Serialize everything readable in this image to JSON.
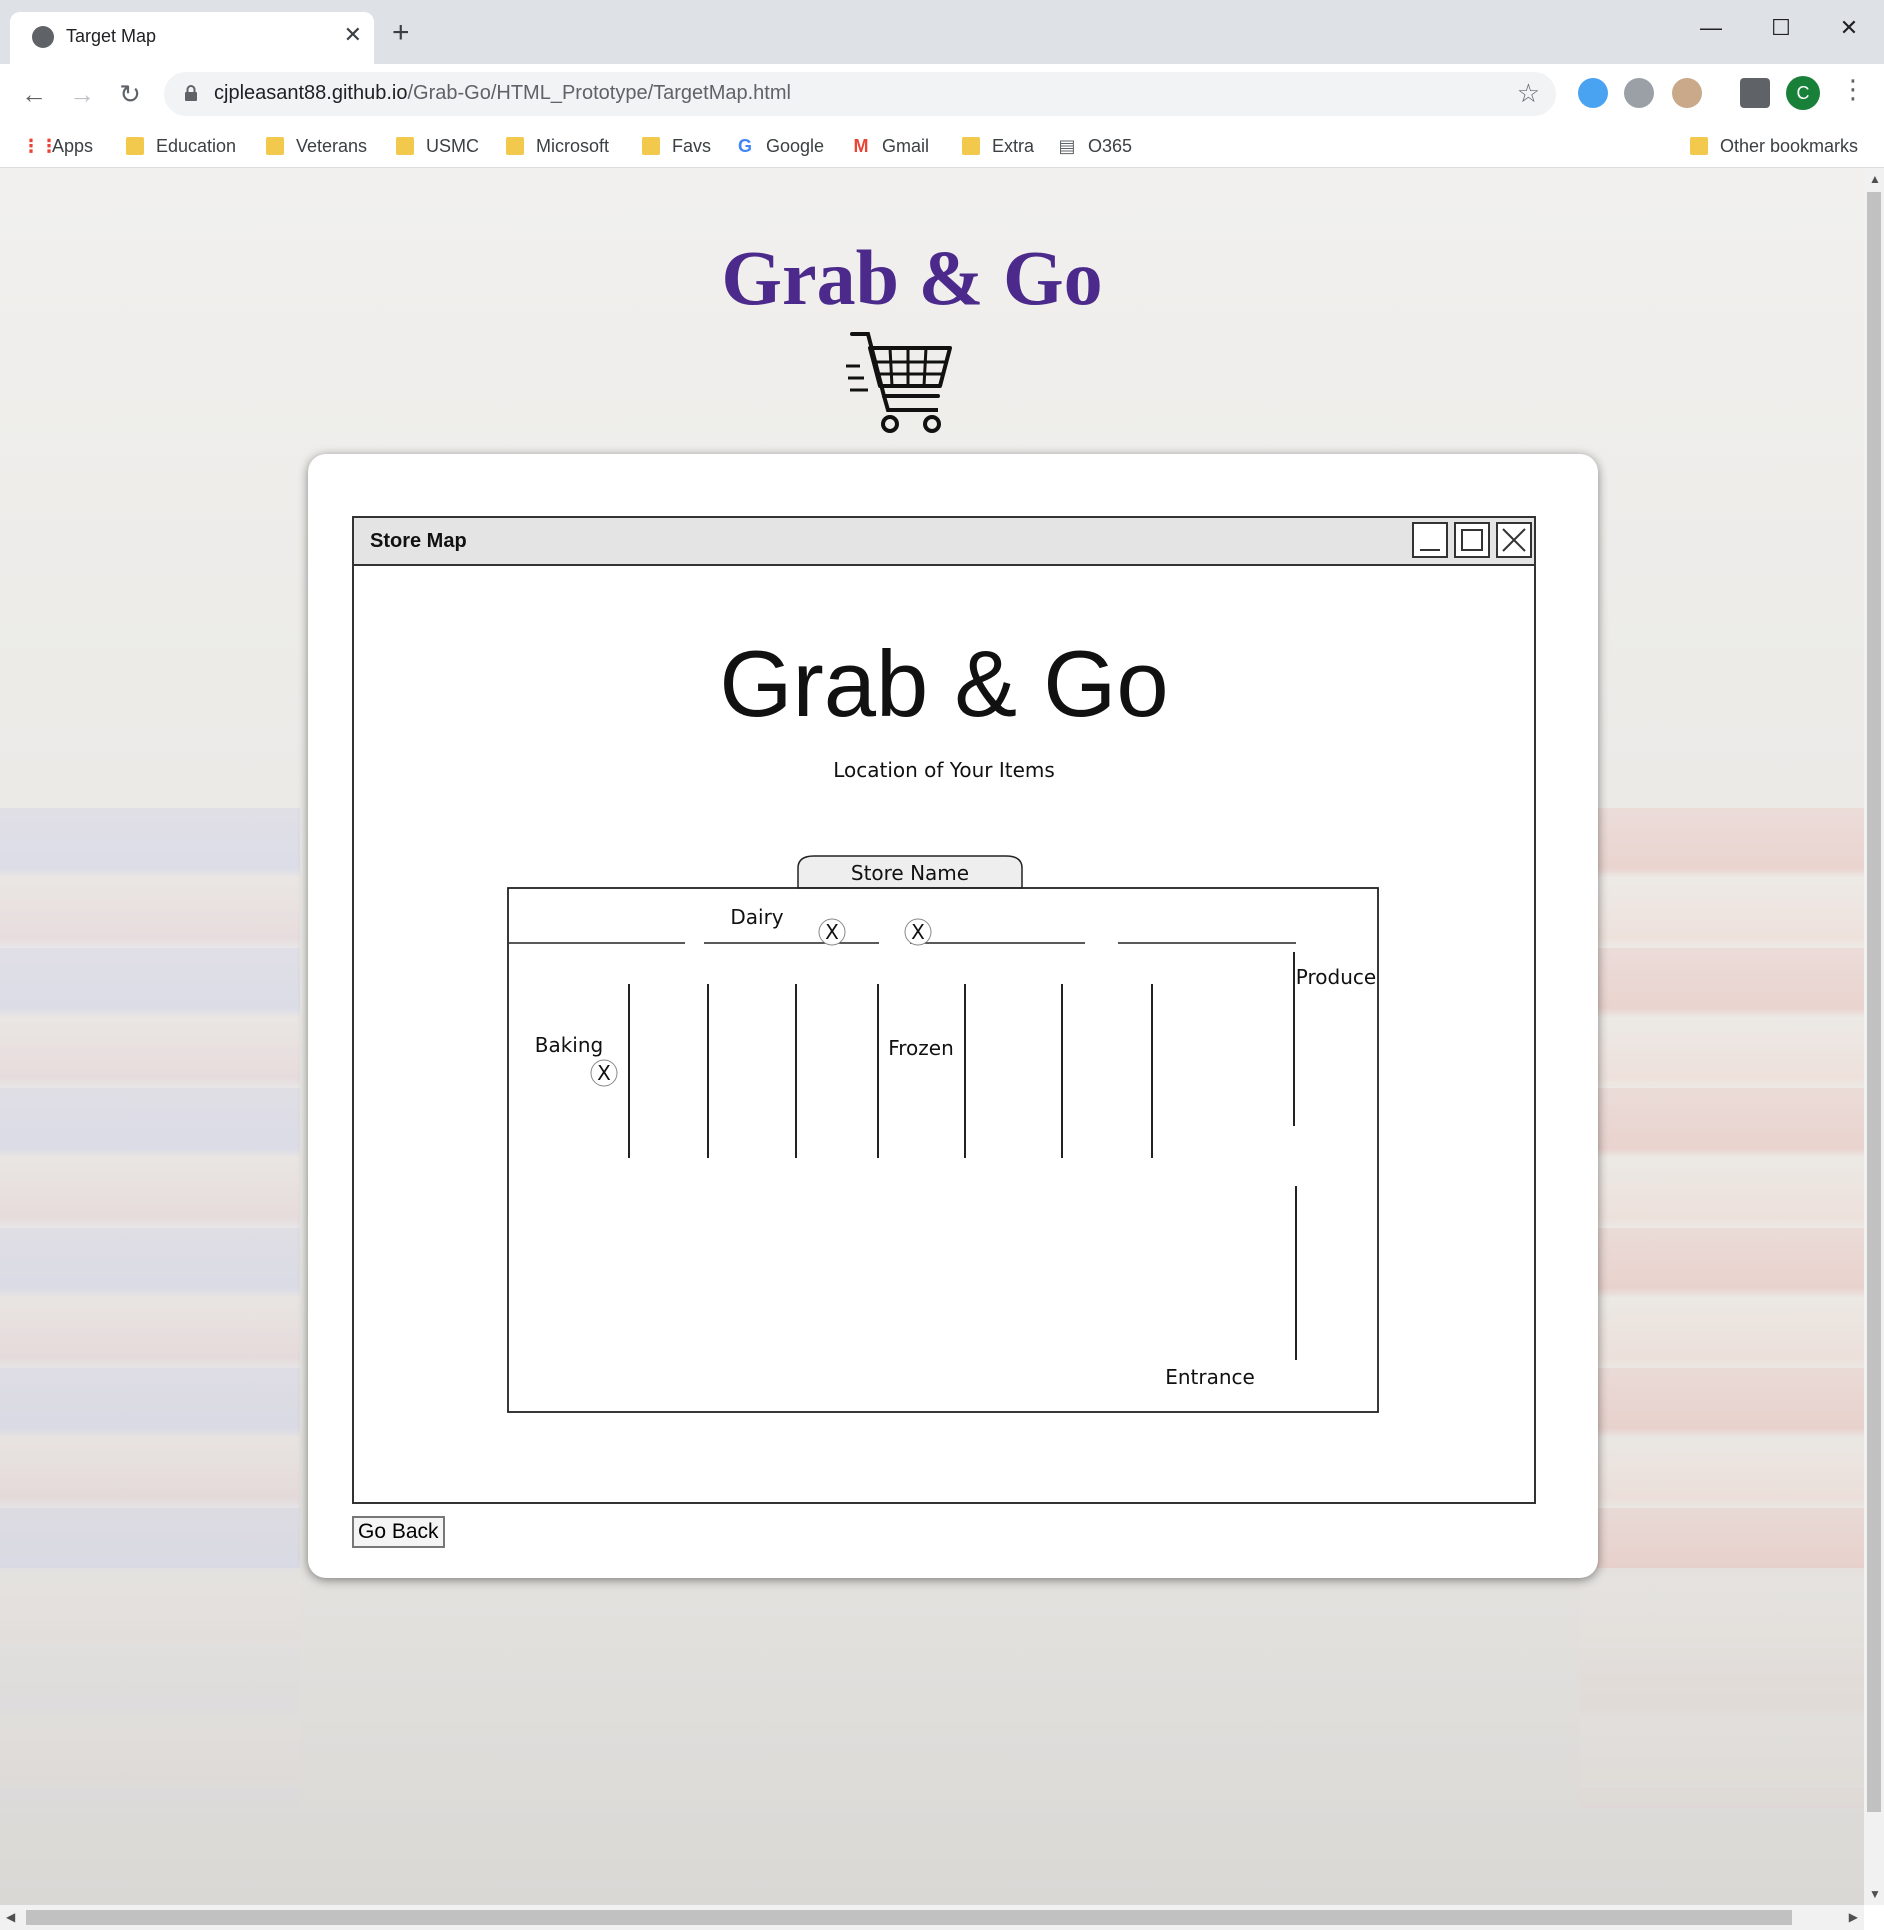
{
  "browser": {
    "tab_title": "Target Map",
    "tab_close": "✕",
    "new_tab": "+",
    "url_host": "cjpleasant88.github.io",
    "url_path": "/Grab-Go/HTML_Prototype/TargetMap.html",
    "profile_initial": "C",
    "window_controls": {
      "minimize": "—",
      "maximize": "☐",
      "close": "✕"
    },
    "nav": {
      "back": "←",
      "forward": "→",
      "reload": "↻",
      "star": "☆",
      "menu": "⋮"
    },
    "bookmarks": [
      {
        "label": "Apps",
        "icon": "apps-grid-icon"
      },
      {
        "label": "Education",
        "icon": "folder-icon"
      },
      {
        "label": "Veterans",
        "icon": "folder-icon"
      },
      {
        "label": "USMC",
        "icon": "folder-icon"
      },
      {
        "label": "Microsoft",
        "icon": "folder-icon"
      },
      {
        "label": "Favs",
        "icon": "folder-icon"
      },
      {
        "label": "Google",
        "icon": "google-icon"
      },
      {
        "label": "Gmail",
        "icon": "gmail-icon"
      },
      {
        "label": "Extra",
        "icon": "folder-icon"
      },
      {
        "label": "O365",
        "icon": "page-icon"
      }
    ],
    "other_bookmarks": "Other bookmarks"
  },
  "page": {
    "site_title": "Grab & Go",
    "mockup": {
      "window_title": "Store Map",
      "heading": "Grab & Go",
      "subheading": "Location of Your Items",
      "store_name_tab": "Store Name",
      "sections": {
        "dairy": "Dairy",
        "baking": "Baking",
        "frozen": "Frozen",
        "produce": "Produce",
        "entrance": "Entrance"
      },
      "marker_glyph": "X"
    },
    "go_back_label": "Go Back"
  },
  "colors": {
    "site_title": "#4b2a8c",
    "chrome_bg": "#dee1e6",
    "avatar_bg": "#188038"
  }
}
